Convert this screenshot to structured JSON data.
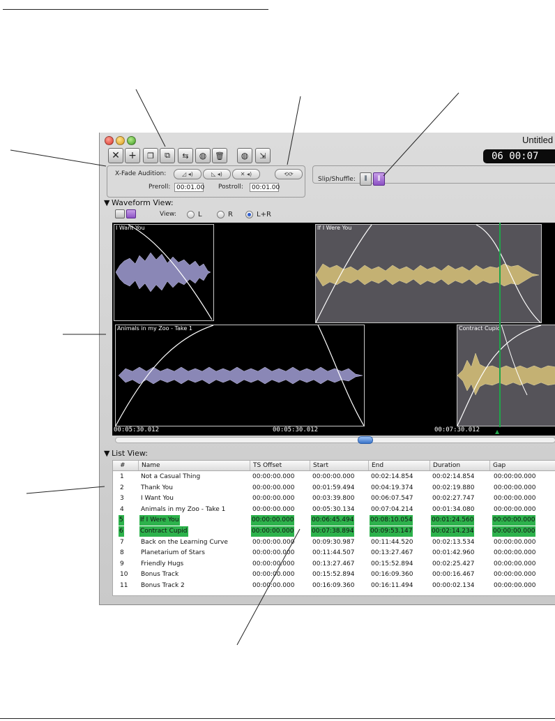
{
  "window": {
    "title": "Untitled"
  },
  "counter": {
    "text": "06  00:07"
  },
  "xfade": {
    "label": "X-Fade Audition:",
    "preroll_label": "Preroll:",
    "preroll_value": "00:01.00",
    "postroll_label": "Postroll:",
    "postroll_value": "00:01.00"
  },
  "slip": {
    "label": "Slip/Shuffle:"
  },
  "waveform": {
    "title": "Waveform View:",
    "view_label": "View:",
    "view_options": [
      "L",
      "R",
      "L+R"
    ],
    "view_selected": "L+R",
    "clips": {
      "c1": "I Want You",
      "c2": "If I Were You",
      "c3": "Animals in my Zoo - Take 1",
      "c4": "Contract Cupid"
    },
    "ruler": [
      "00:05:30.012",
      "00:05:30.012",
      "00:07:30.012"
    ]
  },
  "list": {
    "title": "List View:",
    "columns": [
      "#",
      "Name",
      "TS Offset",
      "Start",
      "End",
      "Duration",
      "Gap"
    ],
    "rows": [
      [
        "1",
        "Not a Casual Thing",
        "00:00:00.000",
        "00:00:00.000",
        "00:02:14.854",
        "00:02:14.854",
        "00:00:00.000"
      ],
      [
        "2",
        "Thank You",
        "00:00:00.000",
        "00:01:59.494",
        "00:04:19.374",
        "00:02:19.880",
        "00:00:00.000"
      ],
      [
        "3",
        "I Want You",
        "00:00:00.000",
        "00:03:39.800",
        "00:06:07.547",
        "00:02:27.747",
        "00:00:00.000"
      ],
      [
        "4",
        "Animals in my Zoo - Take 1",
        "00:00:00.000",
        "00:05:30.134",
        "00:07:04.214",
        "00:01:34.080",
        "00:00:00.000"
      ],
      [
        "5",
        "If I Were You",
        "00:00:00.000",
        "00:06:45.494",
        "00:08:10.054",
        "00:01:24.560",
        "00:00:00.000"
      ],
      [
        "6",
        "Contract Cupid",
        "00:00:00.000",
        "00:07:38.894",
        "00:09:53.147",
        "00:02:14.234",
        "00:00:00.000"
      ],
      [
        "7",
        "Back on the Learning Curve",
        "00:00:00.000",
        "00:09:30.987",
        "00:11:44.520",
        "00:02:13.534",
        "00:00:00.000"
      ],
      [
        "8",
        "Planetarium of Stars",
        "00:00:00.000",
        "00:11:44.507",
        "00:13:27.467",
        "00:01:42.960",
        "00:00:00.000"
      ],
      [
        "9",
        "Friendly Hugs",
        "00:00:00.000",
        "00:13:27.467",
        "00:15:52.894",
        "00:02:25.427",
        "00:00:00.000"
      ],
      [
        "10",
        "Bonus Track",
        "00:00:00.000",
        "00:15:52.894",
        "00:16:09.360",
        "00:00:16.467",
        "00:00:00.000"
      ],
      [
        "11",
        "Bonus Track 2",
        "00:00:00.000",
        "00:16:09.360",
        "00:16:11.494",
        "00:00:02.134",
        "00:00:00.000"
      ]
    ],
    "selected_rows": [
      "5",
      "6"
    ]
  },
  "icons": [
    "close-icon",
    "add-icon",
    "duplicate-icon",
    "split-icon",
    "replace-icon",
    "globe-icon",
    "trash-icon",
    "export-globe-icon",
    "import-icon",
    "loop-icon",
    "slip-icon",
    "shuffle-icon"
  ],
  "colors": {
    "selection": "#2db24c",
    "clip_purple": "#8a87b6",
    "clip_gold": "#c4b173",
    "playhead": "#20a44a"
  }
}
